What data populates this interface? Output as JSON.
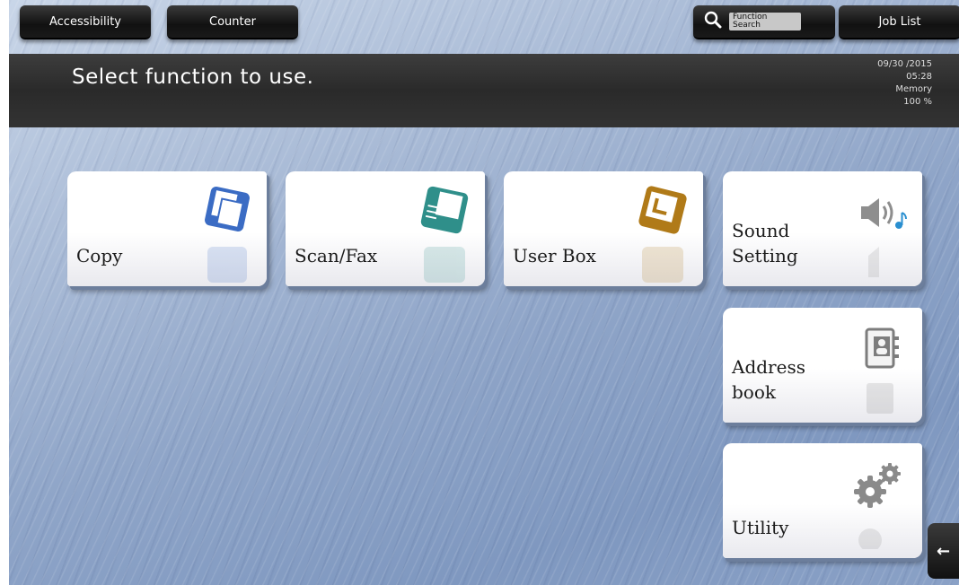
{
  "topbar": {
    "accessibility_label": "Accessibility",
    "counter_label": "Counter",
    "function_search_label": "Function Search",
    "job_list_label": "Job List"
  },
  "message": {
    "text": "Select function to use."
  },
  "status": {
    "date": "09/30 /2015",
    "time": "05:28",
    "memory_label": "Memory",
    "memory_value": "100 %"
  },
  "tiles": [
    {
      "label": "Copy",
      "icon": "copy-icon",
      "color": "#3b6cc4"
    },
    {
      "label": "Scan/Fax",
      "icon": "scan-fax-icon",
      "color": "#2f8f8a"
    },
    {
      "label": "User Box",
      "icon": "user-box-icon",
      "color": "#b07a18"
    },
    {
      "label": "Sound\nSetting",
      "icon": "speaker-icon",
      "color": "#9a9a9a"
    },
    {
      "label": "Address\nbook",
      "icon": "address-book-icon",
      "color": "#9a9a9a"
    },
    {
      "label": "Utility",
      "icon": "gear-icon",
      "color": "#9a9a9a"
    }
  ],
  "side_tab": {
    "icon": "arrow-left-icon",
    "glyph": "←"
  }
}
